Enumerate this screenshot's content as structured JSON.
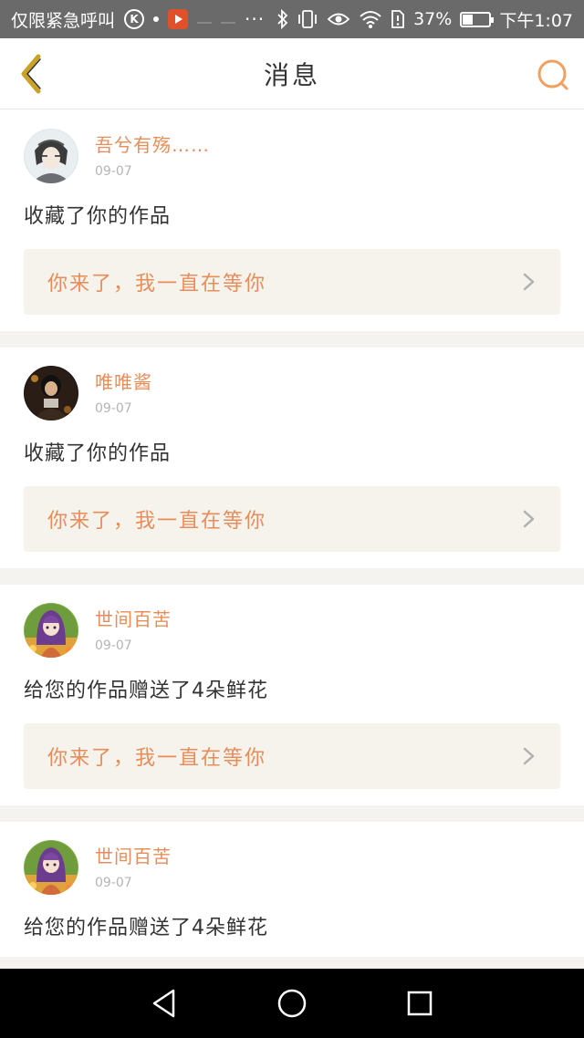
{
  "status_bar": {
    "carrier_text": "仅限紧急呼叫",
    "k_badge": "K",
    "more": "···",
    "battery_percent_text": "37%",
    "battery_level": 0.37,
    "time": "下午1:07"
  },
  "header": {
    "title": "消息"
  },
  "messages": [
    {
      "username": "吾兮有殇……",
      "date": "09-07",
      "action": "收藏了你的作品",
      "work_title": "你来了，我一直在等你",
      "avatar": "avatar-ink-portrait"
    },
    {
      "username": "唯唯酱",
      "date": "09-07",
      "action": "收藏了你的作品",
      "work_title": "你来了，我一直在等你",
      "avatar": "avatar-dark-portrait"
    },
    {
      "username": "世间百苦",
      "date": "09-07",
      "action": "给您的作品赠送了4朵鲜花",
      "work_title": "你来了，我一直在等你",
      "avatar": "avatar-purple-hair-anime"
    },
    {
      "username": "世间百苦",
      "date": "09-07",
      "action": "给您的作品赠送了4朵鲜花",
      "work_title": "",
      "avatar": "avatar-purple-hair-anime"
    }
  ],
  "colors": {
    "accent": "#e88d5a",
    "icon_orange": "#f0a060",
    "back_yellow": "#c9a227",
    "link_bg": "#f5f3ec"
  }
}
